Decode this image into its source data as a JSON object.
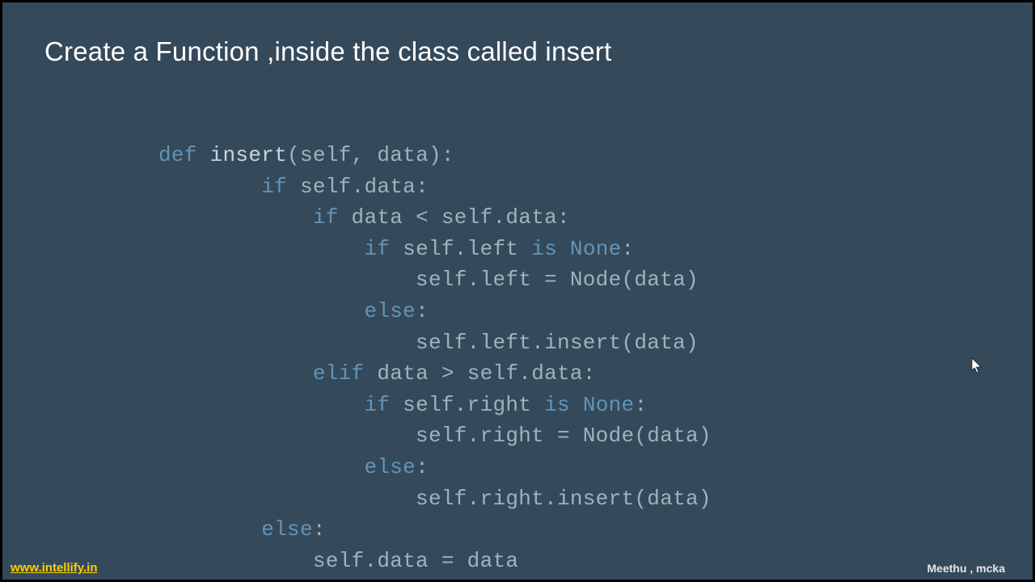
{
  "title": "Create a Function ,inside the class called insert",
  "footer": {
    "link_text": "www.intellify.in",
    "author": "Meethu , mcka"
  },
  "code": {
    "tokens": [
      [
        {
          "t": "def",
          "c": "kw-def"
        },
        {
          "t": " "
        },
        {
          "t": "insert",
          "c": "fn-name"
        },
        {
          "t": "(self, data):"
        }
      ],
      [
        {
          "t": "        "
        },
        {
          "t": "if",
          "c": "kw-flow"
        },
        {
          "t": " self.data:"
        }
      ],
      [
        {
          "t": "            "
        },
        {
          "t": "if",
          "c": "kw-flow"
        },
        {
          "t": " data < self.data:"
        }
      ],
      [
        {
          "t": "                "
        },
        {
          "t": "if",
          "c": "kw-flow"
        },
        {
          "t": " self.left "
        },
        {
          "t": "is",
          "c": "kw-flow"
        },
        {
          "t": " "
        },
        {
          "t": "None",
          "c": "kw-none"
        },
        {
          "t": ":"
        }
      ],
      [
        {
          "t": "                    self.left = Node(data)"
        }
      ],
      [
        {
          "t": "                "
        },
        {
          "t": "else",
          "c": "kw-flow"
        },
        {
          "t": ":"
        }
      ],
      [
        {
          "t": "                    self.left.insert(data)"
        }
      ],
      [
        {
          "t": "            "
        },
        {
          "t": "elif",
          "c": "kw-flow"
        },
        {
          "t": " data > self.data:"
        }
      ],
      [
        {
          "t": "                "
        },
        {
          "t": "if",
          "c": "kw-flow"
        },
        {
          "t": " self.right "
        },
        {
          "t": "is",
          "c": "kw-flow"
        },
        {
          "t": " "
        },
        {
          "t": "None",
          "c": "kw-none"
        },
        {
          "t": ":"
        }
      ],
      [
        {
          "t": "                    self.right = Node(data)"
        }
      ],
      [
        {
          "t": "                "
        },
        {
          "t": "else",
          "c": "kw-flow"
        },
        {
          "t": ":"
        }
      ],
      [
        {
          "t": "                    self.right.insert(data)"
        }
      ],
      [
        {
          "t": "        "
        },
        {
          "t": "else",
          "c": "kw-flow"
        },
        {
          "t": ":"
        }
      ],
      [
        {
          "t": "            self.data = data"
        }
      ]
    ]
  }
}
